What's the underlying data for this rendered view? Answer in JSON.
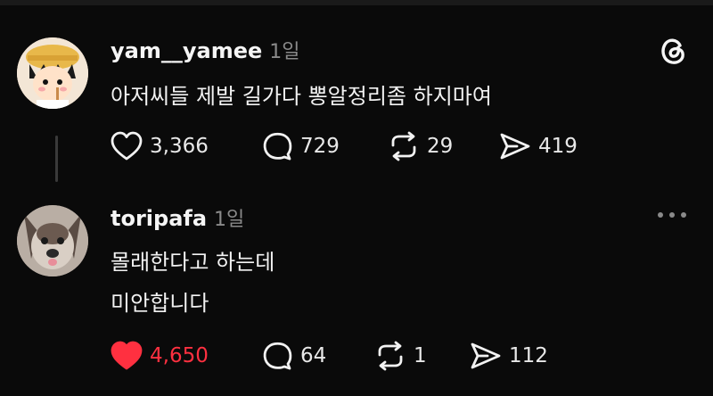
{
  "posts": [
    {
      "username": "yam__yamee",
      "time": "1일",
      "text_lines": [
        "아저씨들 제발 길가다 뽕알정리좀 하지마여"
      ],
      "likes": "3,366",
      "comments": "729",
      "reposts": "29",
      "shares": "419",
      "liked": false
    },
    {
      "username": "toripafa",
      "time": "1일",
      "text_lines": [
        "몰래한다고 하는데",
        "미안합니다"
      ],
      "likes": "4,650",
      "comments": "64",
      "reposts": "1",
      "shares": "112",
      "liked": true
    }
  ],
  "icons": {
    "threads_logo": "threads-logo-icon",
    "more": "more-options-icon",
    "like": "heart-icon",
    "comment": "comment-bubble-icon",
    "repost": "repost-icon",
    "share": "send-icon"
  },
  "colors": {
    "background": "#0a0a0a",
    "liked": "#ff3040",
    "muted": "#8a8a8a"
  }
}
